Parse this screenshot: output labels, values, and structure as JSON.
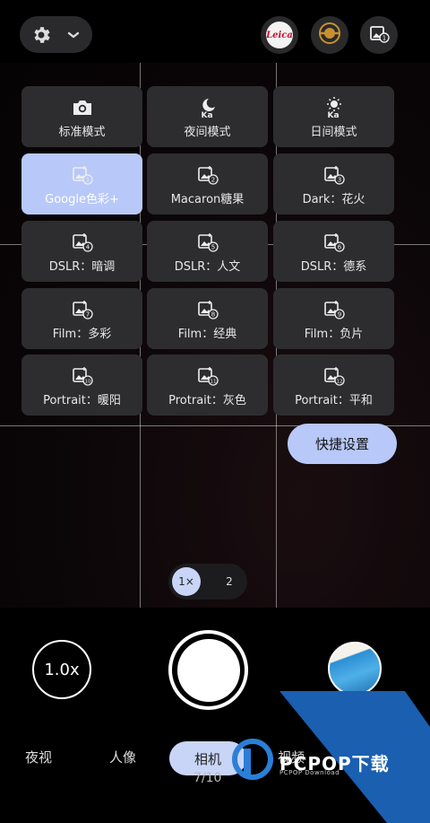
{
  "top_bar": {
    "settings_icon": "gear-icon",
    "dropdown_icon": "chevron-down-icon",
    "leica_label": "Leica",
    "badge_icon": "medal-icon",
    "filter_icon": "photo-filter-1-icon"
  },
  "modes": [
    {
      "label": "标准模式",
      "icon": "camera-icon"
    },
    {
      "label": "夜间模式",
      "icon": "night-ka-icon"
    },
    {
      "label": "日间模式",
      "icon": "day-ka-icon"
    },
    {
      "label": "Google色彩+",
      "icon": "photo-filter-icon",
      "num": "1",
      "selected": true
    },
    {
      "label": "Macaron糖果",
      "icon": "photo-filter-icon",
      "num": "2"
    },
    {
      "label": "Dark：花火",
      "icon": "photo-filter-icon",
      "num": "3"
    },
    {
      "label": "DSLR：暗调",
      "icon": "photo-filter-icon",
      "num": "4"
    },
    {
      "label": "DSLR：人文",
      "icon": "photo-filter-icon",
      "num": "5"
    },
    {
      "label": "DSLR：德系",
      "icon": "photo-filter-icon",
      "num": "6"
    },
    {
      "label": "Film：多彩",
      "icon": "photo-filter-icon",
      "num": "7"
    },
    {
      "label": "Film：经典",
      "icon": "photo-filter-icon",
      "num": "8"
    },
    {
      "label": "Film：负片",
      "icon": "photo-filter-icon",
      "num": "9"
    },
    {
      "label": "Portrait：暖阳",
      "icon": "photo-filter-icon",
      "num": "10"
    },
    {
      "label": "Protrait：灰色",
      "icon": "photo-filter-icon",
      "num": "11"
    },
    {
      "label": "Portrait：平和",
      "icon": "photo-filter-icon",
      "num": "12"
    }
  ],
  "quick_settings_label": "快捷设置",
  "zoom_options": [
    "1×",
    "2"
  ],
  "zoom_level": "1.0x",
  "bottom_tabs": [
    "夜视",
    "人像",
    "相机",
    "视频"
  ],
  "active_tab": "相机",
  "page_counter": "7/10",
  "watermark": {
    "title": "PCPOP下载",
    "subtitle": "PCPOP Download"
  },
  "colors": {
    "accent": "#b8c8f8",
    "tile": "#2d2d2f",
    "background": "#000000"
  }
}
